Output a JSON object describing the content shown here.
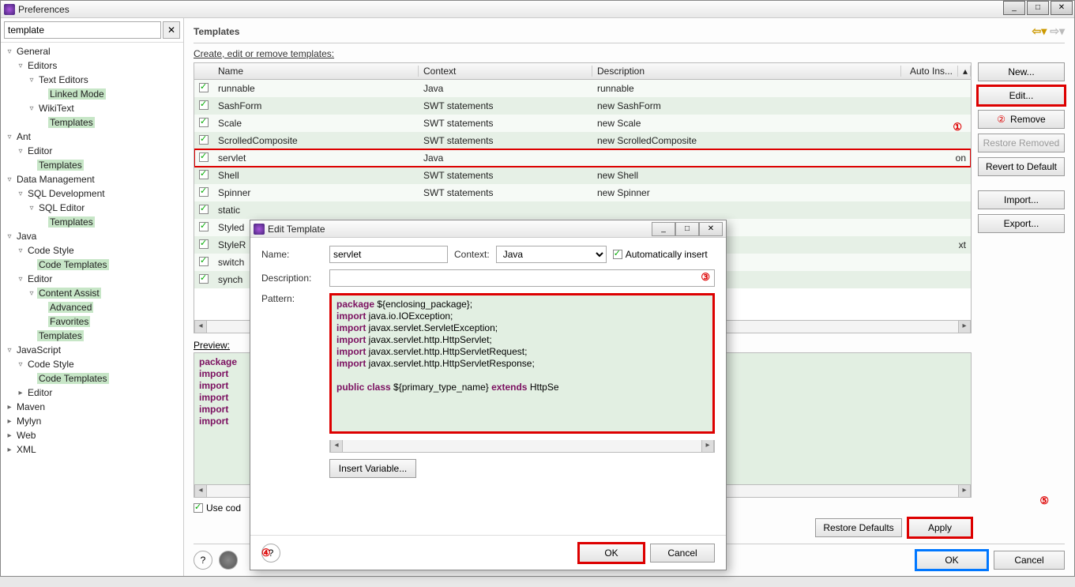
{
  "window": {
    "title": "Preferences"
  },
  "syswin": {
    "min": "_",
    "max": "□",
    "close": "✕"
  },
  "search": {
    "value": "template",
    "clear": "✕"
  },
  "tree": [
    {
      "lvl": 0,
      "tw": "▿",
      "label": "General",
      "hi": false
    },
    {
      "lvl": 1,
      "tw": "▿",
      "label": "Editors",
      "hi": false
    },
    {
      "lvl": 2,
      "tw": "▿",
      "label": "Text Editors",
      "hi": false
    },
    {
      "lvl": 3,
      "tw": "",
      "label": "Linked Mode",
      "hi": true
    },
    {
      "lvl": 2,
      "tw": "▿",
      "label": "WikiText",
      "hi": false
    },
    {
      "lvl": 3,
      "tw": "",
      "label": "Templates",
      "hi": true
    },
    {
      "lvl": 0,
      "tw": "▿",
      "label": "Ant",
      "hi": false
    },
    {
      "lvl": 1,
      "tw": "▿",
      "label": "Editor",
      "hi": false
    },
    {
      "lvl": 2,
      "tw": "",
      "label": "Templates",
      "hi": true
    },
    {
      "lvl": 0,
      "tw": "▿",
      "label": "Data Management",
      "hi": false
    },
    {
      "lvl": 1,
      "tw": "▿",
      "label": "SQL Development",
      "hi": false
    },
    {
      "lvl": 2,
      "tw": "▿",
      "label": "SQL Editor",
      "hi": false
    },
    {
      "lvl": 3,
      "tw": "",
      "label": "Templates",
      "hi": true
    },
    {
      "lvl": 0,
      "tw": "▿",
      "label": "Java",
      "hi": false
    },
    {
      "lvl": 1,
      "tw": "▿",
      "label": "Code Style",
      "hi": false
    },
    {
      "lvl": 2,
      "tw": "",
      "label": "Code Templates",
      "hi": true
    },
    {
      "lvl": 1,
      "tw": "▿",
      "label": "Editor",
      "hi": false
    },
    {
      "lvl": 2,
      "tw": "▿",
      "label": "Content Assist",
      "hi": true
    },
    {
      "lvl": 3,
      "tw": "",
      "label": "Advanced",
      "hi": true
    },
    {
      "lvl": 3,
      "tw": "",
      "label": "Favorites",
      "hi": true
    },
    {
      "lvl": 2,
      "tw": "",
      "label": "Templates",
      "hi": true
    },
    {
      "lvl": 0,
      "tw": "▿",
      "label": "JavaScript",
      "hi": false
    },
    {
      "lvl": 1,
      "tw": "▿",
      "label": "Code Style",
      "hi": false
    },
    {
      "lvl": 2,
      "tw": "",
      "label": "Code Templates",
      "hi": true
    },
    {
      "lvl": 1,
      "tw": "▸",
      "label": "Editor",
      "hi": false
    },
    {
      "lvl": 0,
      "tw": "▸",
      "label": "Maven",
      "hi": false
    },
    {
      "lvl": 0,
      "tw": "▸",
      "label": "Mylyn",
      "hi": false
    },
    {
      "lvl": 0,
      "tw": "▸",
      "label": "Web",
      "hi": false
    },
    {
      "lvl": 0,
      "tw": "▸",
      "label": "XML",
      "hi": false
    }
  ],
  "page": {
    "title": "Templates",
    "hint": "Create, edit or remove templates:"
  },
  "cols": {
    "name": "Name",
    "context": "Context",
    "description": "Description",
    "auto": "Auto Ins..."
  },
  "rows": [
    {
      "on": true,
      "name": "runnable",
      "ctx": "Java",
      "desc": "runnable",
      "auto": ""
    },
    {
      "on": true,
      "name": "SashForm",
      "ctx": "SWT statements",
      "desc": "new SashForm",
      "auto": ""
    },
    {
      "on": true,
      "name": "Scale",
      "ctx": "SWT statements",
      "desc": "new Scale",
      "auto": ""
    },
    {
      "on": true,
      "name": "ScrolledComposite",
      "ctx": "SWT statements",
      "desc": "new ScrolledComposite",
      "auto": ""
    },
    {
      "on": true,
      "name": "servlet",
      "ctx": "Java",
      "desc": "",
      "auto": "on",
      "sel": true
    },
    {
      "on": true,
      "name": "Shell",
      "ctx": "SWT statements",
      "desc": "new Shell",
      "auto": ""
    },
    {
      "on": true,
      "name": "Spinner",
      "ctx": "SWT statements",
      "desc": "new Spinner",
      "auto": ""
    },
    {
      "on": true,
      "name": "static",
      "ctx": "",
      "desc": "",
      "auto": ""
    },
    {
      "on": true,
      "name": "Styled",
      "ctx": "",
      "desc": "",
      "auto": ""
    },
    {
      "on": true,
      "name": "StyleR",
      "ctx": "",
      "desc": "",
      "auto": "xt"
    },
    {
      "on": true,
      "name": "switch",
      "ctx": "",
      "desc": "",
      "auto": ""
    },
    {
      "on": true,
      "name": "synch",
      "ctx": "",
      "desc": "",
      "auto": ""
    }
  ],
  "buttons": {
    "new": "New...",
    "edit": "Edit...",
    "remove": "Remove",
    "restore_removed": "Restore Removed",
    "revert": "Revert to Default",
    "import": "Import...",
    "export": "Export...",
    "restore_defaults": "Restore Defaults",
    "apply": "Apply",
    "ok": "OK",
    "cancel": "Cancel"
  },
  "badges": {
    "one": "①",
    "two": "②",
    "three": "③",
    "four": "④",
    "five": "⑤"
  },
  "preview": {
    "label": "Preview:",
    "lines": [
      "package",
      "import",
      "import",
      "import",
      "import",
      "import"
    ]
  },
  "usecode": {
    "label": "Use cod"
  },
  "modal": {
    "title": "Edit Template",
    "name_label": "Name:",
    "name_value": "servlet",
    "context_label": "Context:",
    "context_value": "Java",
    "auto_label": "Automatically insert",
    "auto_checked": true,
    "desc_label": "Description:",
    "desc_value": "",
    "pattern_label": "Pattern:",
    "pattern_lines": [
      {
        "t": "package ",
        "k": true,
        "r": "${enclosing_package};"
      },
      {
        "t": "import ",
        "k": true,
        "r": "java.io.IOException;"
      },
      {
        "t": "import ",
        "k": true,
        "r": "javax.servlet.ServletException;"
      },
      {
        "t": "import ",
        "k": true,
        "r": "javax.servlet.http.HttpServlet;"
      },
      {
        "t": "import ",
        "k": true,
        "r": "javax.servlet.http.HttpServletRequest;"
      },
      {
        "t": "import ",
        "k": true,
        "r": "javax.servlet.http.HttpServletResponse;"
      },
      {
        "t": "",
        "k": false,
        "r": ""
      },
      {
        "t": "public class ",
        "k": true,
        "r": "${primary_type_name}",
        "t2": " extends ",
        "r2": "HttpSe"
      }
    ],
    "insert_var": "Insert Variable...",
    "ok": "OK",
    "cancel": "Cancel"
  }
}
